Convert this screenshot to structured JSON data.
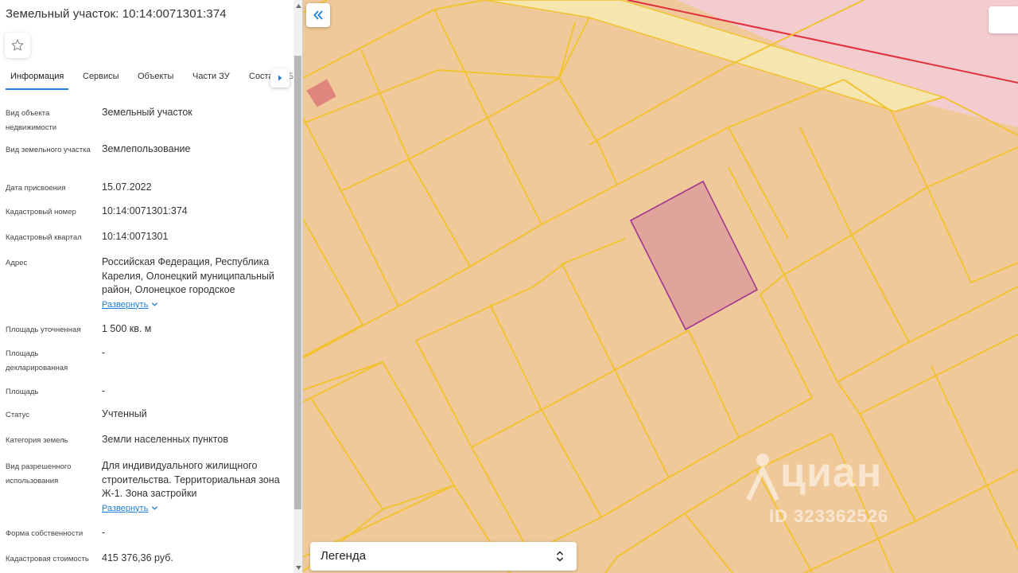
{
  "panel": {
    "title": "Земельный участок: 10:14:0071301:374",
    "tabs": [
      "Информация",
      "Сервисы",
      "Объекты",
      "Части ЗУ",
      "Соста"
    ],
    "tab_overflow_ghost": "Б",
    "expand_label": "Развернуть",
    "fields": [
      {
        "label": "Вид объекта недвижимости",
        "value": "Земельный участок"
      },
      {
        "label": "Вид земельного участка",
        "value": "Землепользование"
      },
      {
        "label": "Дата присвоения",
        "value": "15.07.2022"
      },
      {
        "label": "Кадастровый номер",
        "value": "10:14:0071301:374"
      },
      {
        "label": "Кадастровый квартал",
        "value": "10:14:0071301"
      },
      {
        "label": "Адрес",
        "value": "Российская Федерация, Республика Карелия, Олонецкий муниципальный район, Олонецкое городское"
      },
      {
        "label": "Площадь уточненная",
        "value": "1 500 кв. м"
      },
      {
        "label": "Площадь декларированная",
        "value": "-"
      },
      {
        "label": "Площадь",
        "value": "-"
      },
      {
        "label": "Статус",
        "value": "Учтенный"
      },
      {
        "label": "Категория земель",
        "value": "Земли населенных пунктов"
      },
      {
        "label": "Вид разрешенного использования",
        "value": "Для индивидуального жилищного строительства. Территориальная зона Ж-1. Зона застройки"
      },
      {
        "label": "Форма собственности",
        "value": "-"
      },
      {
        "label": "Кадастровая стоимость",
        "value": "415 376,36 руб."
      }
    ]
  },
  "map": {
    "legend_label": "Легенда",
    "watermark_brand": "циан",
    "watermark_id": "ID 323362526",
    "colors": {
      "parcel_fill": "#f0c99a",
      "parcel_border": "#f1c232",
      "selected_fill": "#e0a49a",
      "selected_border": "#a0368f",
      "zone_pink": "#f3cccf",
      "zone_border_red": "#e0313c",
      "road_fill": "#f5e6b0",
      "accent": "#1f7fd6"
    }
  }
}
